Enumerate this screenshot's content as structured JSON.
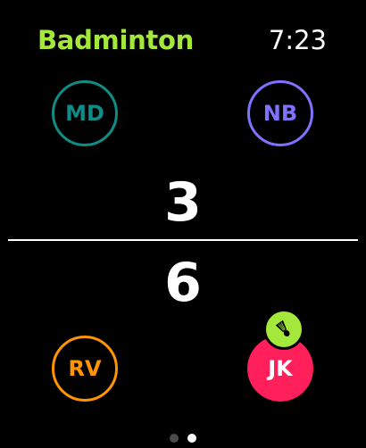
{
  "header": {
    "app_title": "Badminton",
    "time": "7:23"
  },
  "players": {
    "top_left": {
      "initials": "MD",
      "color": "#0f8c85"
    },
    "top_right": {
      "initials": "NB",
      "color": "#7f72ff"
    },
    "bottom_left": {
      "initials": "RV",
      "color": "#ff9500"
    },
    "bottom_right": {
      "initials": "JK",
      "color": "#ff1f5b",
      "serving": true
    }
  },
  "scores": {
    "top": "3",
    "bottom": "6"
  },
  "serve_indicator": {
    "icon": "shuttlecock-icon",
    "color": "#a4e83c"
  },
  "pagination": {
    "count": 2,
    "active_index": 1
  },
  "colors": {
    "accent": "#a4e83c",
    "background": "#000000"
  }
}
